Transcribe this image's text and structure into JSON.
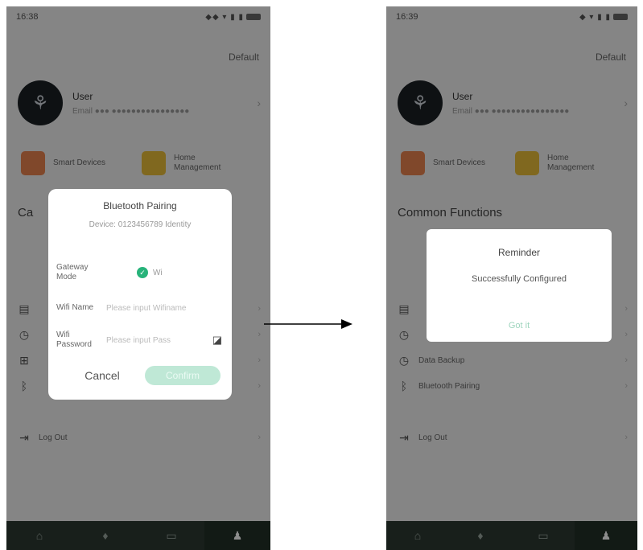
{
  "left": {
    "status": {
      "time": "16:38",
      "icons": "◆◆ ▾ ▮ ▮"
    },
    "default_link": "Default",
    "profile": {
      "name": "User",
      "email": "Email ●●● ●●●●●●●●●●●●●●●●"
    },
    "shortcuts": [
      {
        "label": "Smart Devices"
      },
      {
        "label": "Home Management"
      }
    ],
    "section_title": "Ca",
    "menu": [
      {
        "icon": "list-icon"
      },
      {
        "icon": "clock-icon"
      },
      {
        "icon": "plus-box-icon"
      },
      {
        "icon": "bluetooth-icon"
      }
    ],
    "logout": "Log Out",
    "dialog": {
      "title": "Bluetooth Pairing",
      "device": "Device: 0123456789 Identity",
      "gateway_label": "Gateway Mode",
      "gateway_value": "Wi",
      "wifi_name_label": "Wifi Name",
      "wifi_name_placeholder": "Please input Wifiname",
      "wifi_password_label": "Wifi Password",
      "wifi_password_placeholder": "Please input Pass",
      "cancel": "Cancel",
      "confirm": "Confirm"
    }
  },
  "right": {
    "status": {
      "time": "16:39",
      "icons": "◆ ▾ ▮ ▮"
    },
    "default_link": "Default",
    "profile": {
      "name": "User",
      "email": "Email ●●● ●●●●●●●●●●●●●●●●"
    },
    "shortcuts": [
      {
        "label": "Smart Devices"
      },
      {
        "label": "Home Management"
      }
    ],
    "section_title": "Common Functions",
    "menu": [
      {
        "label": "",
        "icon": "list-icon"
      },
      {
        "label": "",
        "icon": "clock-icon"
      },
      {
        "label": "Data Backup",
        "icon": "clock-icon"
      },
      {
        "label": "Bluetooth Pairing",
        "icon": "bluetooth-icon"
      }
    ],
    "logout": "Log Out",
    "dialog": {
      "title": "Reminder",
      "message": "Successfully Configured",
      "button": "Got it"
    }
  },
  "tabs": [
    "home-icon",
    "mic-icon",
    "device-icon",
    "user-icon"
  ],
  "colors": {
    "accent": "#27b37a",
    "tabbar": "#2c3a32"
  }
}
